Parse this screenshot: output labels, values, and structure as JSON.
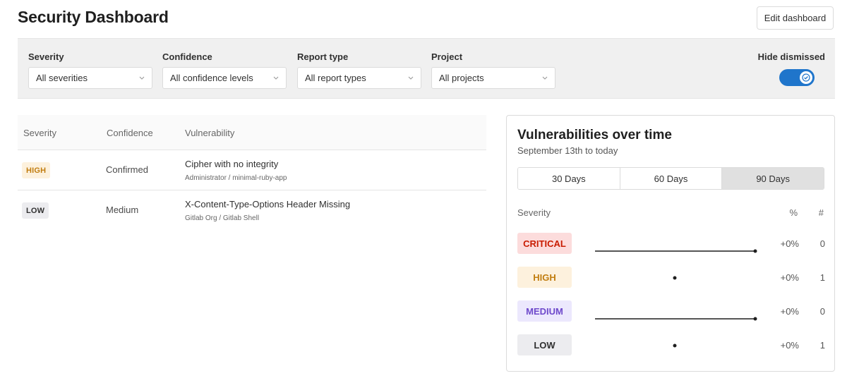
{
  "header": {
    "title": "Security Dashboard",
    "edit_label": "Edit dashboard"
  },
  "filters": {
    "severity": {
      "label": "Severity",
      "value": "All severities"
    },
    "confidence": {
      "label": "Confidence",
      "value": "All confidence levels"
    },
    "report_type": {
      "label": "Report type",
      "value": "All report types"
    },
    "project": {
      "label": "Project",
      "value": "All projects"
    },
    "hide_dismissed": {
      "label": "Hide dismissed",
      "enabled": true
    }
  },
  "table": {
    "columns": [
      "Severity",
      "Confidence",
      "Vulnerability"
    ],
    "rows": [
      {
        "severity": "HIGH",
        "confidence": "Confirmed",
        "title": "Cipher with no integrity",
        "project": "Administrator / minimal-ruby-app"
      },
      {
        "severity": "LOW",
        "confidence": "Medium",
        "title": "X-Content-Type-Options Header Missing",
        "project": "Gitlab Org / Gitlab Shell"
      }
    ]
  },
  "chart_card": {
    "title": "Vulnerabilities over time",
    "subtitle": "September 13th to today",
    "ranges": [
      "30 Days",
      "60 Days",
      "90 Days"
    ],
    "active_range": "90 Days",
    "columns": {
      "severity": "Severity",
      "percent": "%",
      "count": "#"
    },
    "rows": [
      {
        "label": "CRITICAL",
        "percent": "+0%",
        "count": "0"
      },
      {
        "label": "HIGH",
        "percent": "+0%",
        "count": "1"
      },
      {
        "label": "MEDIUM",
        "percent": "+0%",
        "count": "0"
      },
      {
        "label": "LOW",
        "percent": "+0%",
        "count": "1"
      }
    ]
  },
  "colors": {
    "accent": "#1f75cb",
    "critical_bg": "#fcdcdc",
    "critical_text": "#c91c00",
    "high_bg": "#fdf1dd",
    "high_text": "#c17d10",
    "medium_bg": "#ece8fd",
    "medium_text": "#6e49cb",
    "low_bg": "#ececef",
    "low_text": "#303030"
  }
}
